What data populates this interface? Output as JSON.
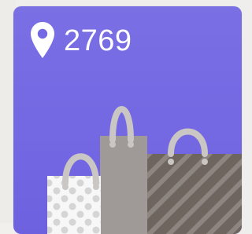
{
  "promo_card": {
    "location_count": "2769",
    "icon": "location-pin-icon",
    "accent_color": "#766ae3"
  },
  "illustration": {
    "name": "shopping-bags",
    "colors": {
      "polka_bag": "#f7f7f7",
      "polka_dots": "#d5d5d5",
      "taupe_bag": "#9f9a97",
      "striped_bag": "#6f655f",
      "stripe": "#8c8580",
      "handle": "#c9c6c3"
    }
  }
}
